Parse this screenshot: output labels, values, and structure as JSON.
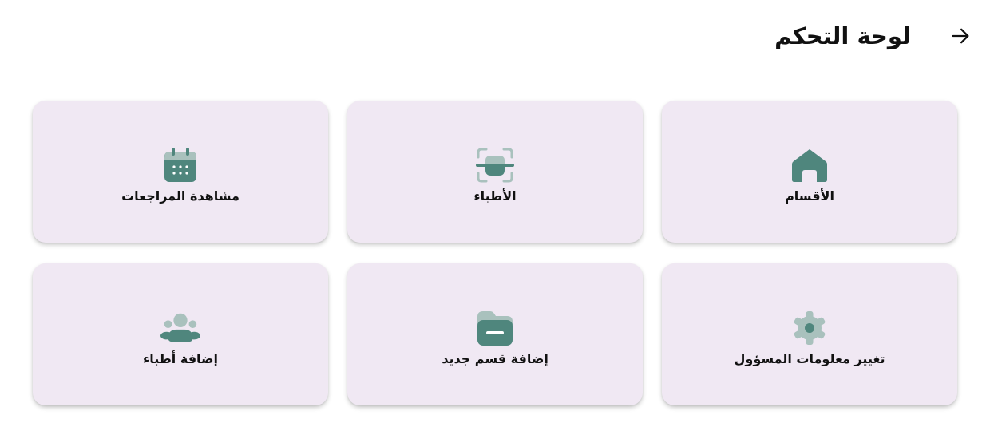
{
  "header": {
    "title": "لوحة التحكم",
    "back_icon": "arrow-back-icon"
  },
  "colors": {
    "card_bg": "#f0e8f3",
    "icon_primary": "#4f867d",
    "icon_light": "#a9c1bd"
  },
  "cards": [
    {
      "label": "الأقسام",
      "icon": "home-icon"
    },
    {
      "label": "الأطباء",
      "icon": "face-scan-icon"
    },
    {
      "label": "مشاهدة المراجعات",
      "icon": "calendar-icon"
    },
    {
      "label": "تغيير معلومات المسؤول",
      "icon": "gear-icon"
    },
    {
      "label": "إضافة قسم جديد",
      "icon": "folder-minus-icon"
    },
    {
      "label": "إضافة أطباء",
      "icon": "users-group-icon"
    }
  ]
}
